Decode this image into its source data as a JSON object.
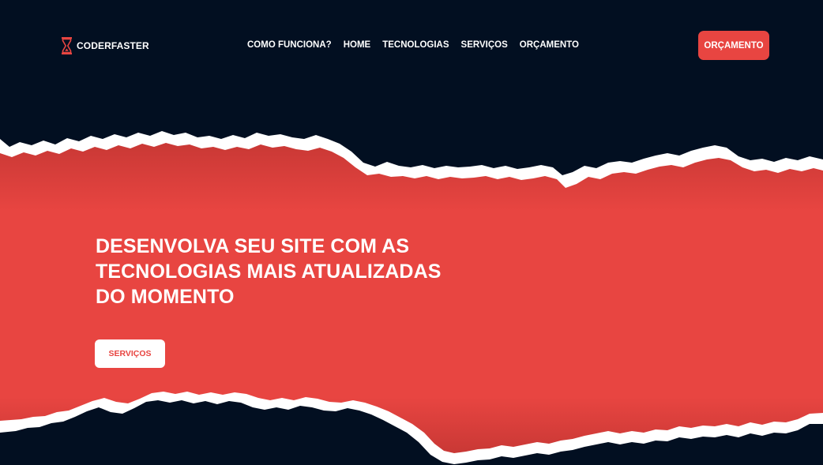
{
  "brand": {
    "name": "CODERFASTER",
    "icon": "hourglass-icon"
  },
  "nav": {
    "items": [
      {
        "label": "COMO FUNCIONA?"
      },
      {
        "label": "HOME"
      },
      {
        "label": "TECNOLOGIAS"
      },
      {
        "label": "SERVIÇOS"
      },
      {
        "label": "ORÇAMENTO"
      }
    ]
  },
  "header": {
    "cta_label": "ORÇAMENTO"
  },
  "hero": {
    "title_lines": [
      "DESENVOLVA SEU SITE COM AS",
      "TECNOLOGIAS MAIS ATUALIZADAS",
      "DO MOMENTO"
    ],
    "button_label": "SERVIÇOS"
  },
  "colors": {
    "background": "#020f21",
    "accent": "#e84541",
    "text": "#ffffff"
  }
}
